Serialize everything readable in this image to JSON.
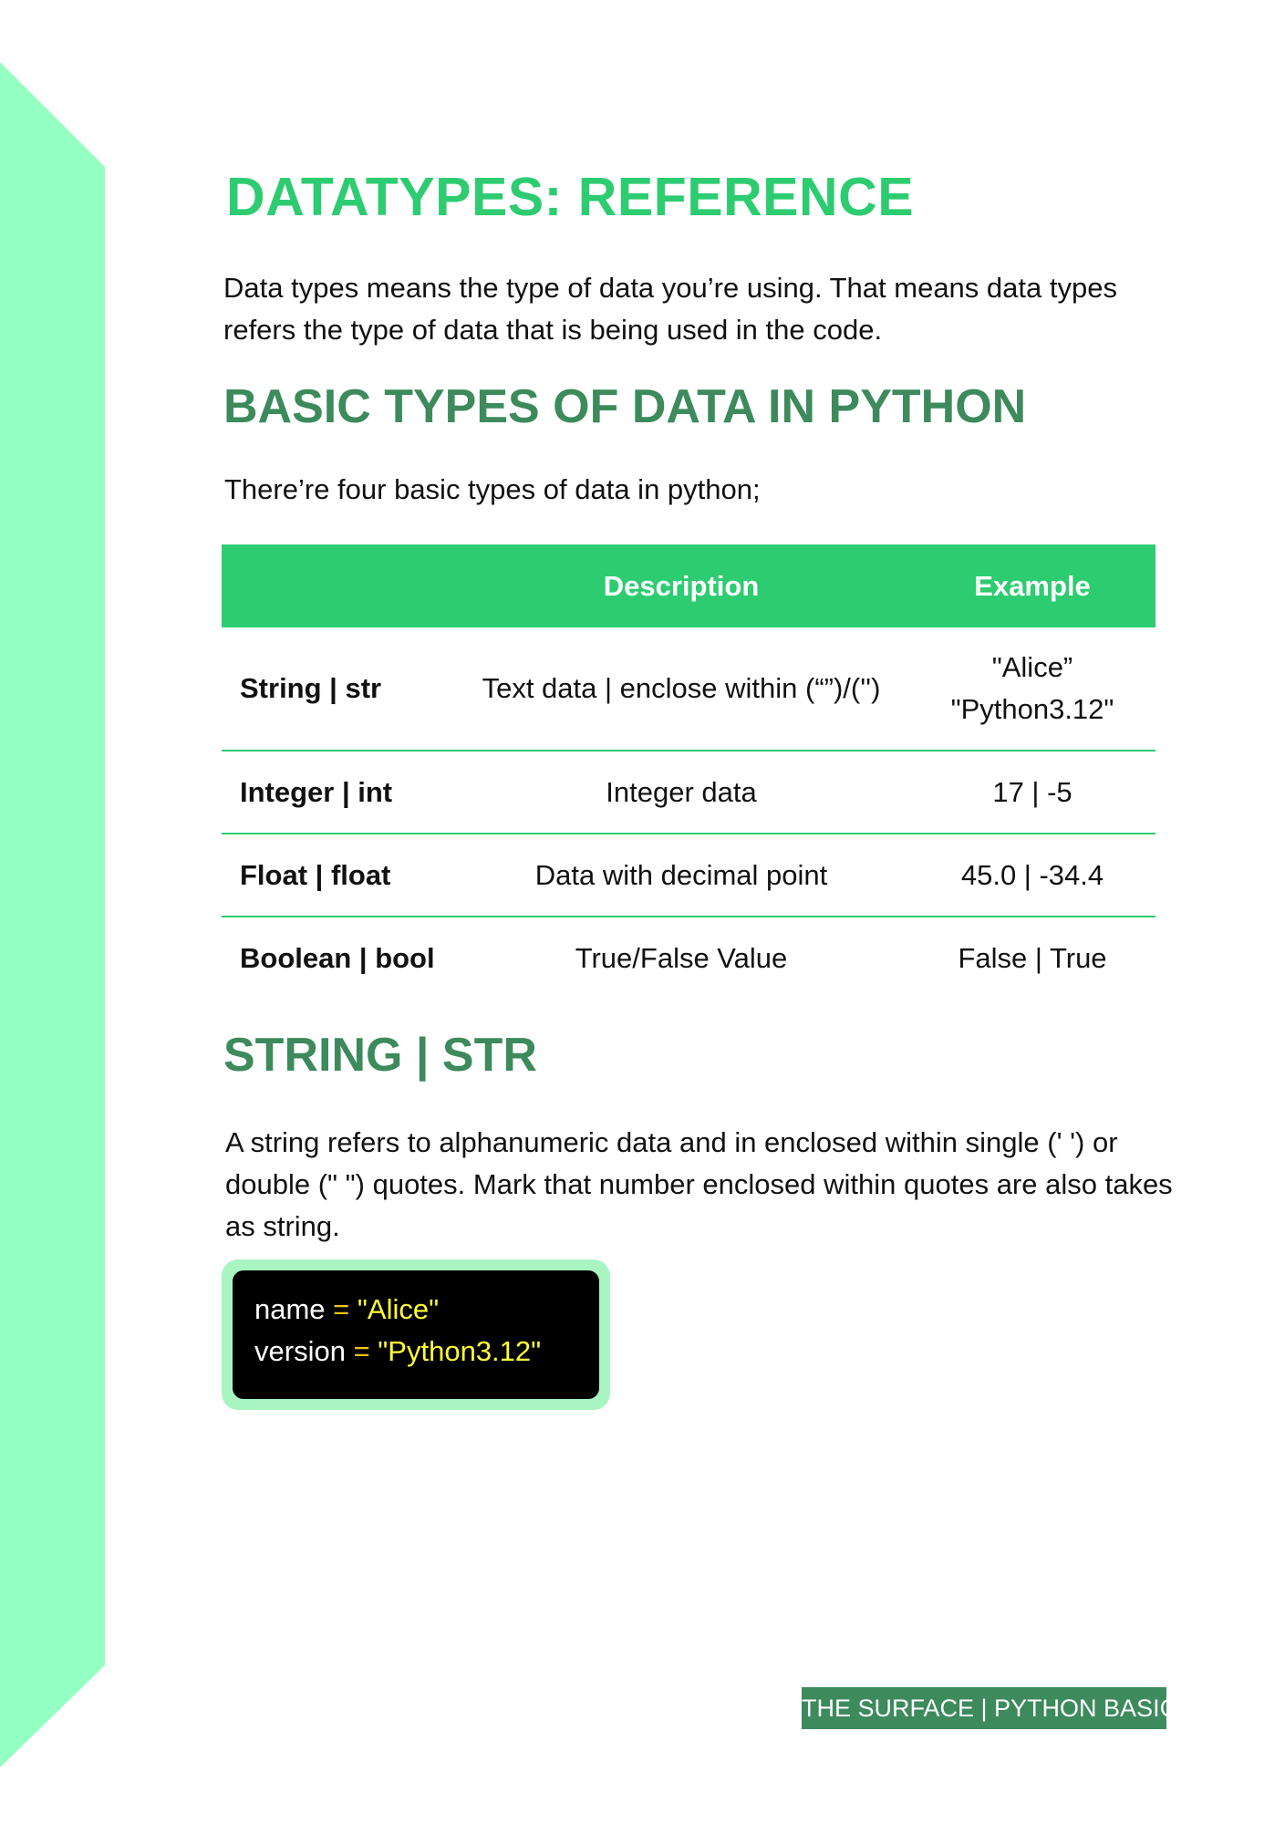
{
  "page": {
    "title": "DATATYPES: REFERENCE",
    "intro": "Data types means the type of data you’re using. That means data types refers the type of data that is being used in the code."
  },
  "basic_section": {
    "heading": "BASIC TYPES OF DATA IN PYTHON",
    "lead": "There’re four basic types of data in python;"
  },
  "table": {
    "headers": [
      "",
      "Description",
      "Example"
    ],
    "rows": [
      {
        "name": "String | str",
        "description": "Text data | enclose within (“”)/('')",
        "example": "\"Alice” \"Python3.12\""
      },
      {
        "name": "Integer | int",
        "description": "Integer data",
        "example": "17 | -5"
      },
      {
        "name": "Float | float",
        "description": "Data with decimal point",
        "example": "45.0 | -34.4"
      },
      {
        "name": "Boolean | bool",
        "description": "True/False Value",
        "example": "False | True"
      }
    ]
  },
  "string_section": {
    "heading": "STRING | STR",
    "body": "A string refers to alphanumeric data and in enclosed within single (' ') or double (\" \") quotes. Mark that number enclosed within quotes are also takes as string."
  },
  "code_example": {
    "lines": [
      {
        "var": "name",
        "op": "=",
        "value": "\"Alice\""
      },
      {
        "var": "version",
        "op": "=",
        "value": "\"Python3.12\""
      }
    ]
  },
  "footer": {
    "label": "THE SURFACE | PYTHON BASICS"
  },
  "colors": {
    "accent_green": "#2ecc71",
    "heading_green": "#3d8a5c",
    "side_band": "#94ffc2",
    "code_frame": "#a8f5c2"
  }
}
